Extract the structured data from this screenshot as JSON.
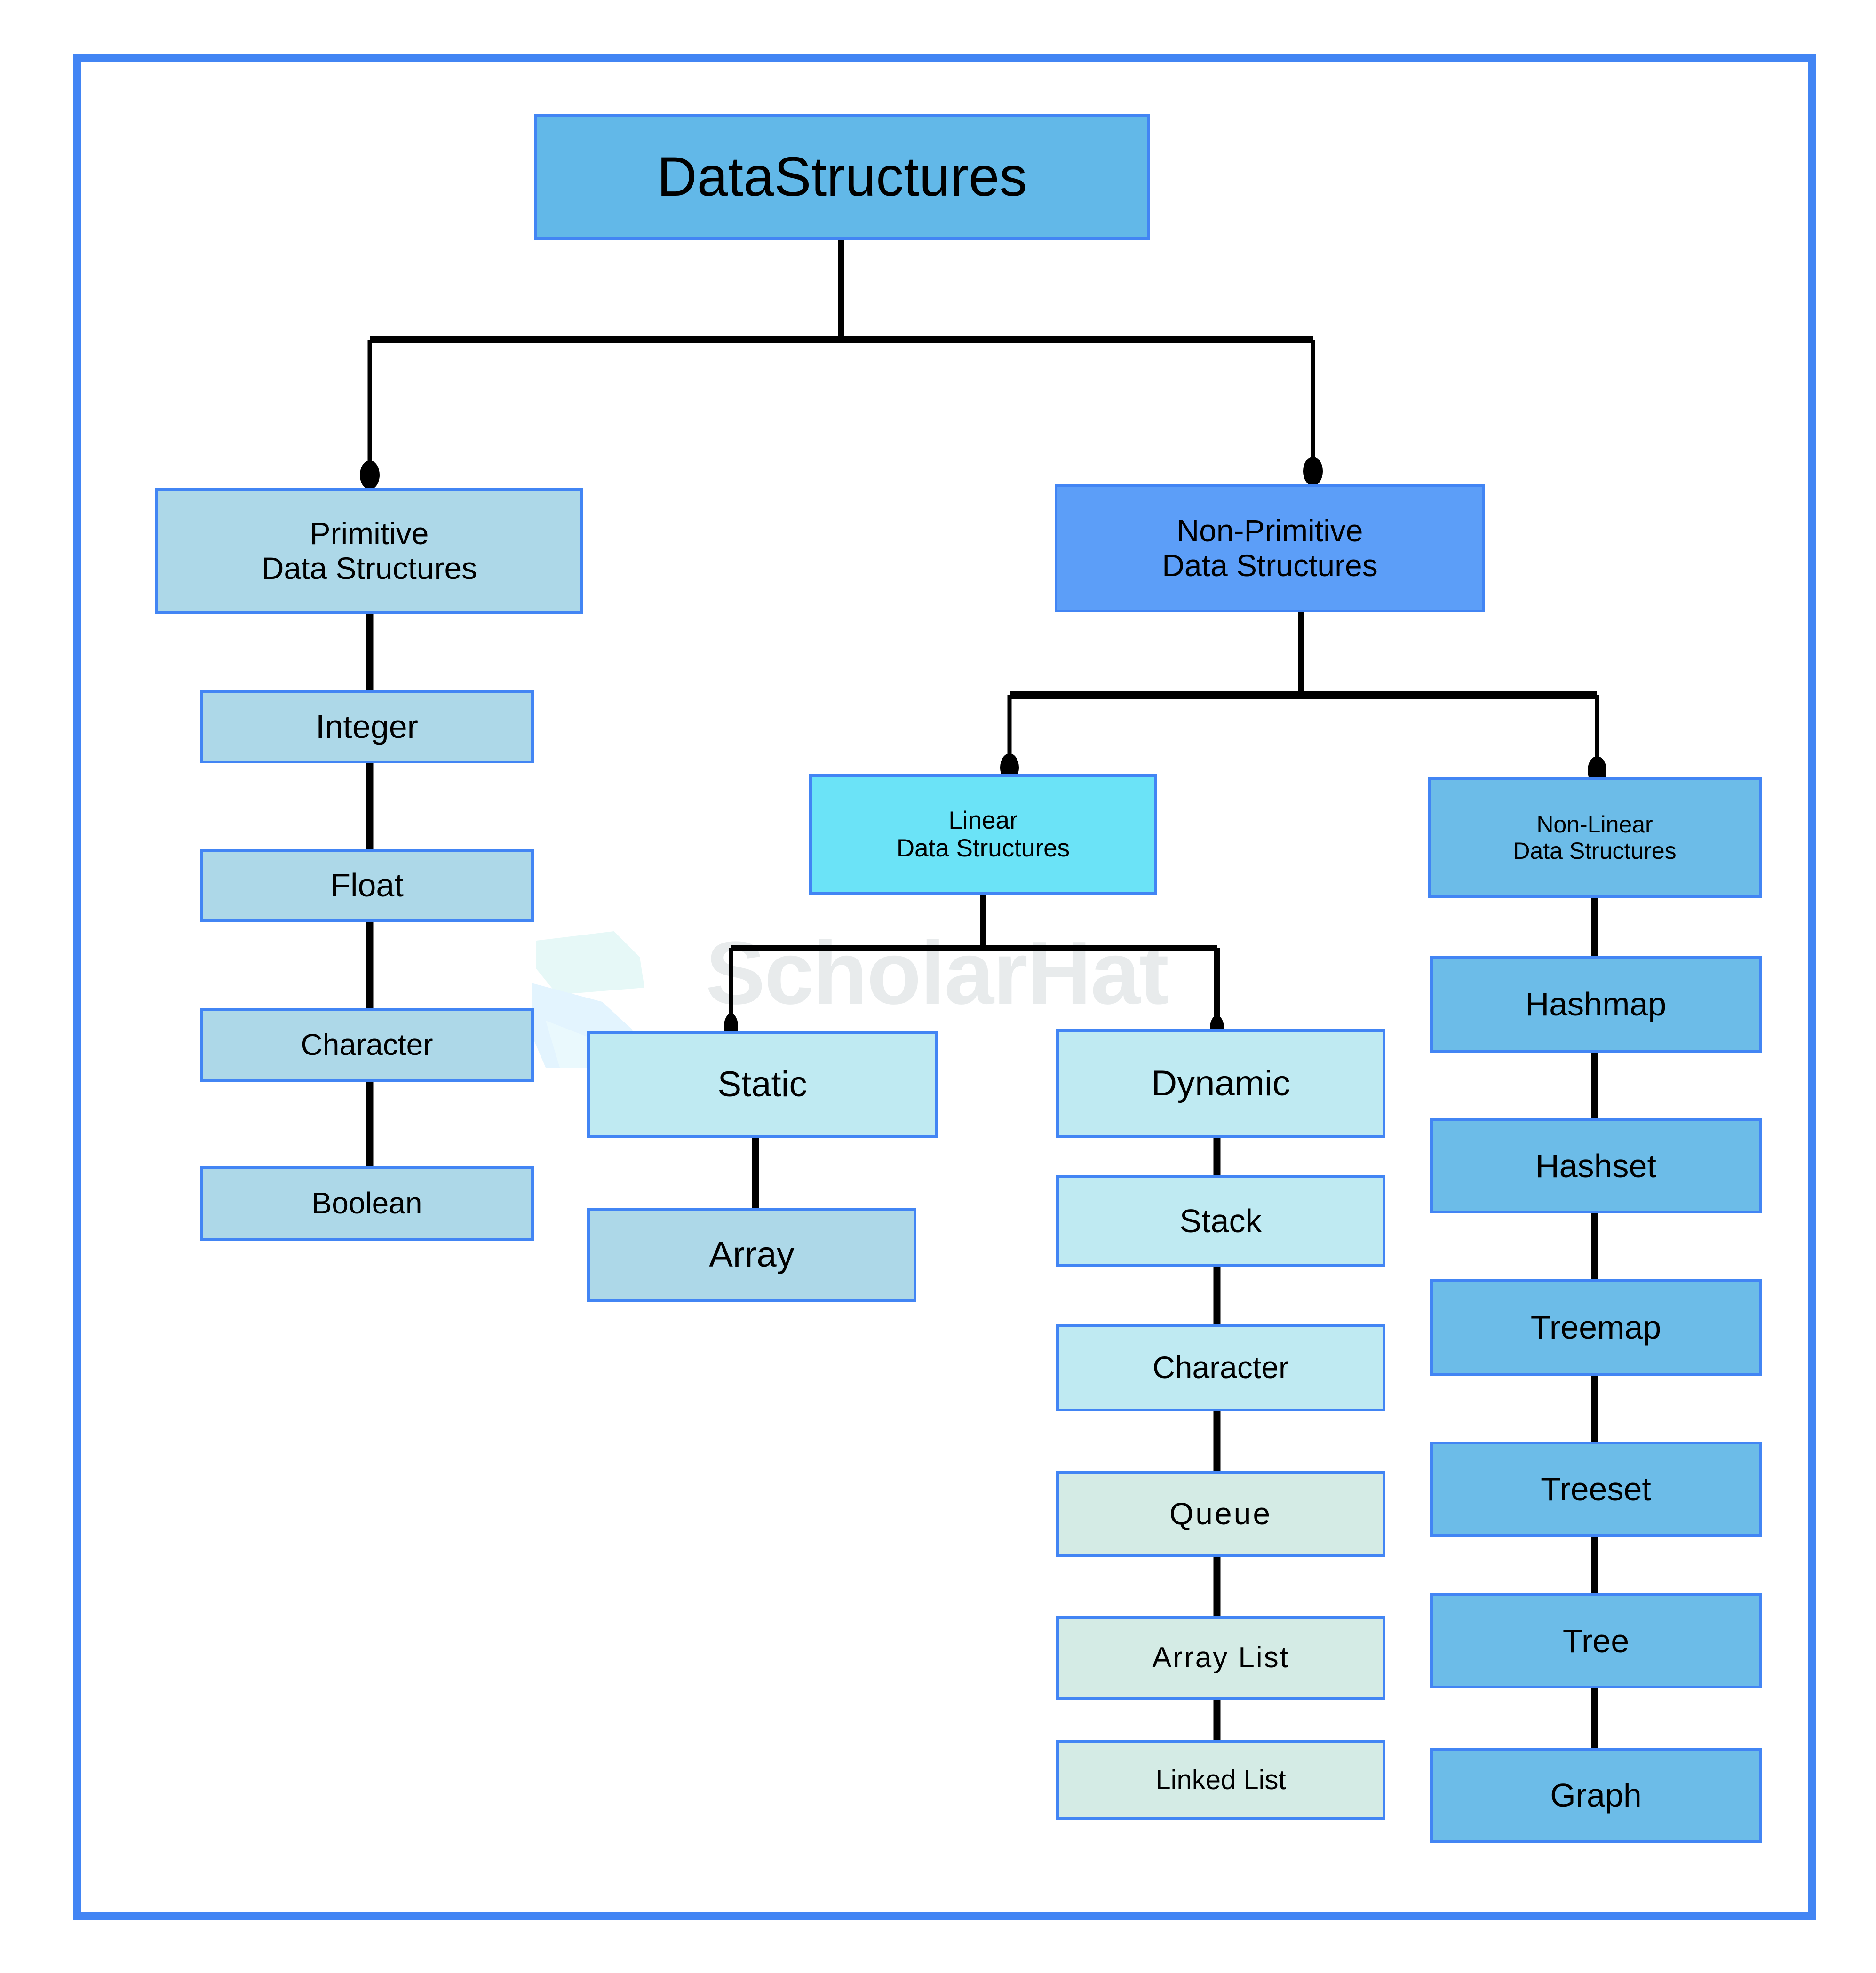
{
  "diagram": {
    "title": "DataStructures",
    "watermark": {
      "text": "ScholarHat",
      "logo_icon": "hexagon-ribbon-logo-icon"
    },
    "frame": {
      "border_color": "#4285F4"
    },
    "palette": {
      "border": "#4285F4",
      "root_fill": "#62B8E8",
      "primitive_fill": "#ADD8E8",
      "nonprimitive_fill": "#5C9EF8",
      "linear_fill": "#6BE3F7",
      "nonlinear_fill": "#6CBCE8",
      "static_fill": "#BFEAF2",
      "dynamic_fill": "#BFEAF2",
      "queue_fill": "#D4EBE5",
      "line": "#000000"
    },
    "nodes": [
      {
        "id": "root",
        "label": "DataStructures"
      },
      {
        "id": "primitive",
        "label": "Primitive\nData Structures"
      },
      {
        "id": "integer",
        "label": "Integer"
      },
      {
        "id": "float",
        "label": "Float"
      },
      {
        "id": "char_prim",
        "label": "Character"
      },
      {
        "id": "boolean",
        "label": "Boolean"
      },
      {
        "id": "nonprimitive",
        "label": "Non-Primitive\nData Structures"
      },
      {
        "id": "linear",
        "label": "Linear\nData Structures"
      },
      {
        "id": "nonlinear",
        "label": "Non-Linear\nData Structures"
      },
      {
        "id": "static",
        "label": "Static"
      },
      {
        "id": "array",
        "label": "Array"
      },
      {
        "id": "dynamic",
        "label": "Dynamic"
      },
      {
        "id": "stack",
        "label": "Stack"
      },
      {
        "id": "char_dyn",
        "label": "Character"
      },
      {
        "id": "queue",
        "label": "Queue"
      },
      {
        "id": "arraylist",
        "label": "Array List"
      },
      {
        "id": "linkedlist",
        "label": "Linked List"
      },
      {
        "id": "hashmap",
        "label": "Hashmap"
      },
      {
        "id": "hashset",
        "label": "Hashset"
      },
      {
        "id": "treemap",
        "label": "Treemap"
      },
      {
        "id": "treeset",
        "label": "Treeset"
      },
      {
        "id": "tree",
        "label": "Tree"
      },
      {
        "id": "graph",
        "label": "Graph"
      }
    ]
  }
}
